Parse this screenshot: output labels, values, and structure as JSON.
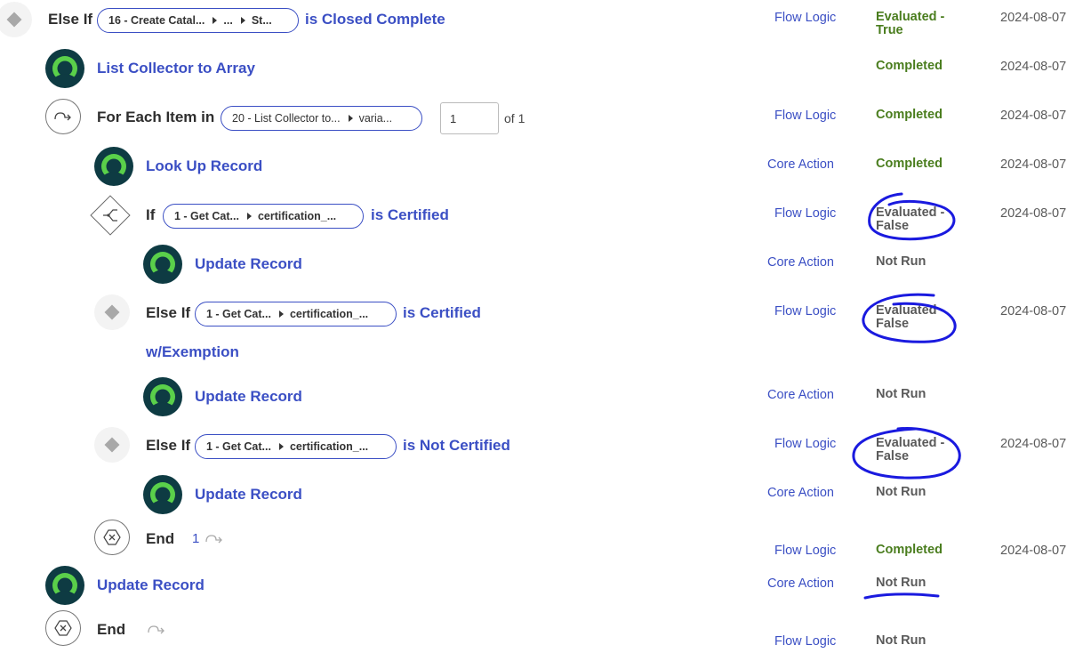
{
  "rows": {
    "r1": {
      "keyword": "Else If",
      "pill": [
        "16 - Create Catal...",
        "...",
        "St..."
      ],
      "condition": "is Closed Complete",
      "type": "Flow Logic",
      "status": [
        "Evaluated -",
        "True"
      ],
      "date": "2024-08-07"
    },
    "r2": {
      "name": "List Collector to Array",
      "status": "Completed",
      "date": "2024-08-07"
    },
    "r3": {
      "keyword": "For Each Item in",
      "pill": [
        "20 - List Collector to...",
        "varia..."
      ],
      "input_value": "1",
      "of_text": "of 1",
      "type": "Flow Logic",
      "status": "Completed",
      "date": "2024-08-07"
    },
    "r4": {
      "name": "Look Up Record",
      "type": "Core Action",
      "status": "Completed",
      "date": "2024-08-07"
    },
    "r5": {
      "keyword": "If",
      "pill": [
        "1 - Get Cat...",
        "certification_..."
      ],
      "condition": "is Certified",
      "type": "Flow Logic",
      "status": [
        "Evaluated -",
        "False"
      ],
      "date": "2024-08-07"
    },
    "r6": {
      "name": "Update Record",
      "type": "Core Action",
      "status": "Not Run"
    },
    "r7": {
      "keyword": "Else If",
      "pill": [
        "1 - Get Cat...",
        "certification_..."
      ],
      "condition": "is Certified",
      "condition2": "w/Exemption",
      "type": "Flow Logic",
      "status": [
        "Evaluated -",
        "False"
      ],
      "date": "2024-08-07"
    },
    "r8": {
      "name": "Update Record",
      "type": "Core Action",
      "status": "Not Run"
    },
    "r9": {
      "keyword": "Else If",
      "pill": [
        "1 - Get Cat...",
        "certification_..."
      ],
      "condition": "is Not Certified",
      "type": "Flow Logic",
      "status": [
        "Evaluated -",
        "False"
      ],
      "date": "2024-08-07"
    },
    "r10": {
      "name": "Update Record",
      "type": "Core Action",
      "status": "Not Run"
    },
    "r11": {
      "keyword": "End",
      "count": "1",
      "type": "Flow Logic",
      "status": "Completed",
      "date": "2024-08-07"
    },
    "r12": {
      "name": "Update Record",
      "type": "Core Action",
      "status": "Not Run"
    },
    "r13": {
      "keyword": "End",
      "type": "Flow Logic",
      "status": "Not Run"
    }
  },
  "colors": {
    "link": "#3b4fc4",
    "completed": "#4a7d1e",
    "annotation": "#1a1adf",
    "action_icon_bg": "#0e3b43",
    "action_icon_fg": "#5ad04a"
  },
  "icons": {
    "action": "user-circle-icon",
    "else_if": "diamond-icon",
    "if": "branch-icon",
    "for_each": "loop-icon",
    "end": "end-x-icon"
  }
}
